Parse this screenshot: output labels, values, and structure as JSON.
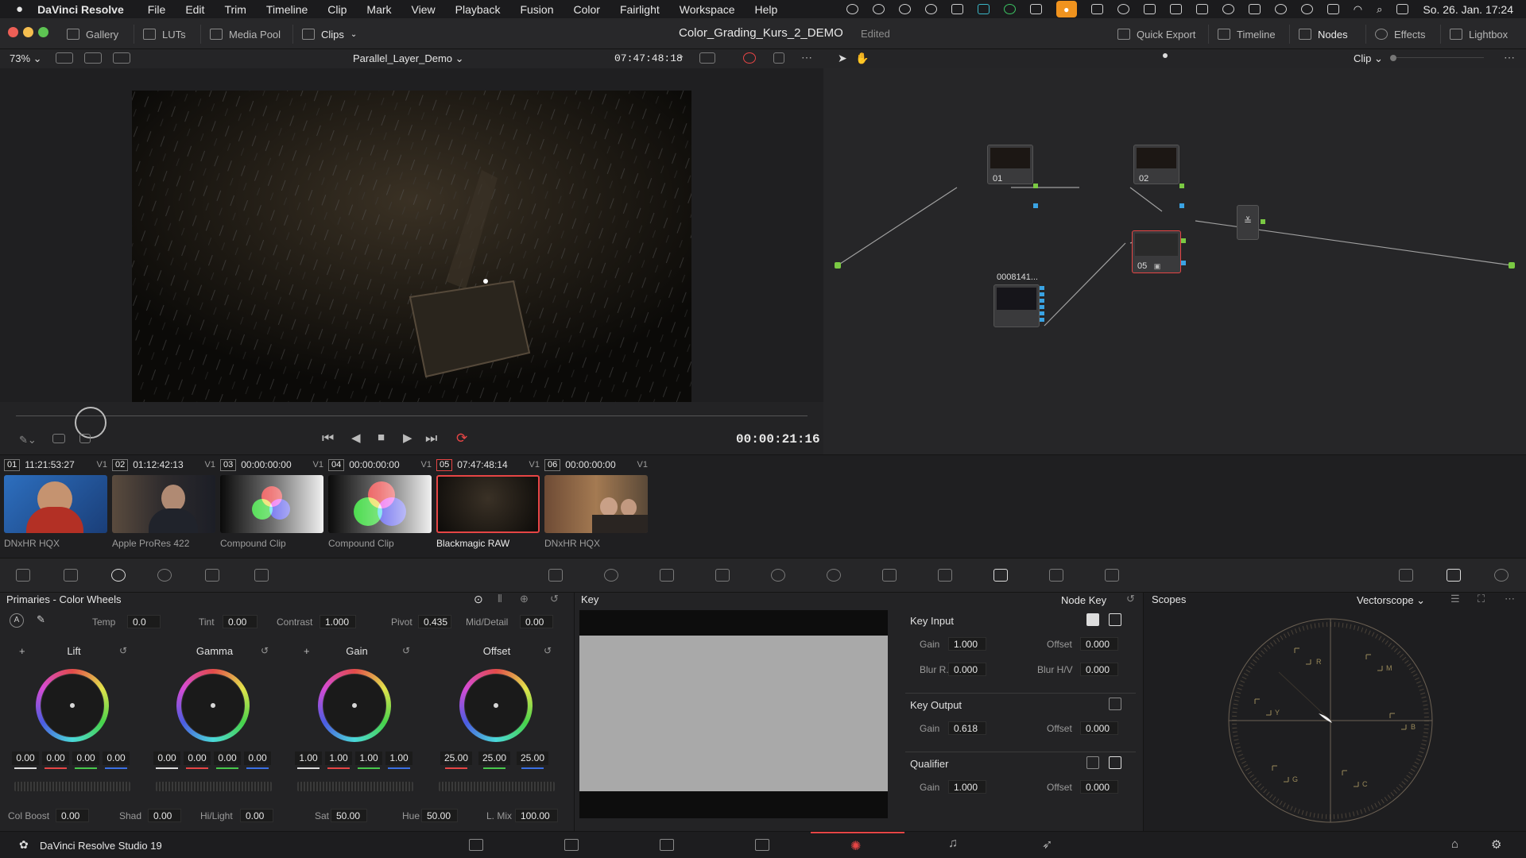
{
  "menubar": {
    "app": "DaVinci Resolve",
    "items": [
      "File",
      "Edit",
      "Trim",
      "Timeline",
      "Clip",
      "Mark",
      "View",
      "Playback",
      "Fusion",
      "Color",
      "Fairlight",
      "Workspace",
      "Help"
    ],
    "datetime": "So. 26. Jan.  17:24"
  },
  "toolbar": {
    "gallery": "Gallery",
    "luts": "LUTs",
    "media_pool": "Media Pool",
    "clips": "Clips",
    "project_title": "Color_Grading_Kurs_2_DEMO",
    "status": "Edited",
    "quick_export": "Quick Export",
    "timeline": "Timeline",
    "nodes": "Nodes",
    "effects": "Effects",
    "lightbox": "Lightbox"
  },
  "viewer": {
    "zoom": "73%",
    "timeline_name": "Parallel_Layer_Demo",
    "timecode_top": "07:47:48:18",
    "timecode": "00:00:21:16"
  },
  "node_editor": {
    "mode": "Clip",
    "nodes": [
      {
        "label": "01"
      },
      {
        "label": "02"
      },
      {
        "label": "05"
      },
      {
        "label": "0008141..."
      }
    ]
  },
  "clips": [
    {
      "num": "01",
      "tc": "11:21:53:27",
      "track": "V1",
      "codec": "DNxHR HQX"
    },
    {
      "num": "02",
      "tc": "01:12:42:13",
      "track": "V1",
      "codec": "Apple ProRes 422"
    },
    {
      "num": "03",
      "tc": "00:00:00:00",
      "track": "V1",
      "codec": "Compound Clip"
    },
    {
      "num": "04",
      "tc": "00:00:00:00",
      "track": "V1",
      "codec": "Compound Clip"
    },
    {
      "num": "05",
      "tc": "07:47:48:14",
      "track": "V1",
      "codec": "Blackmagic RAW"
    },
    {
      "num": "06",
      "tc": "00:00:00:00",
      "track": "V1",
      "codec": "DNxHR HQX"
    }
  ],
  "primaries": {
    "title": "Primaries - Color Wheels",
    "temp_label": "Temp",
    "temp": "0.0",
    "tint_label": "Tint",
    "tint": "0.00",
    "contrast_label": "Contrast",
    "contrast": "1.000",
    "pivot_label": "Pivot",
    "pivot": "0.435",
    "middetail_label": "Mid/Detail",
    "middetail": "0.00",
    "wheels": [
      {
        "name": "Lift",
        "values": [
          "0.00",
          "0.00",
          "0.00",
          "0.00"
        ]
      },
      {
        "name": "Gamma",
        "values": [
          "0.00",
          "0.00",
          "0.00",
          "0.00"
        ]
      },
      {
        "name": "Gain",
        "values": [
          "1.00",
          "1.00",
          "1.00",
          "1.00"
        ]
      },
      {
        "name": "Offset",
        "values": [
          "25.00",
          "25.00",
          "25.00"
        ]
      }
    ],
    "colboost_label": "Col Boost",
    "colboost": "0.00",
    "shad_label": "Shad",
    "shad": "0.00",
    "hilight_label": "Hi/Light",
    "hilight": "0.00",
    "sat_label": "Sat",
    "sat": "50.00",
    "hue_label": "Hue",
    "hue": "50.00",
    "lmix_label": "L. Mix",
    "lmix": "100.00"
  },
  "key": {
    "title": "Key",
    "node_key": "Node Key",
    "key_input": "Key Input",
    "gain_label": "Gain",
    "offset_label": "Offset",
    "blur_r_label": "Blur R.",
    "blur_hv_label": "Blur H/V",
    "ki_gain": "1.000",
    "ki_offset": "0.000",
    "ki_blur_r": "0.000",
    "ki_blur_hv": "0.000",
    "key_output": "Key Output",
    "ko_gain": "0.618",
    "ko_offset": "0.000",
    "qualifier": "Qualifier",
    "q_gain": "1.000",
    "q_offset": "0.000"
  },
  "scopes": {
    "title": "Scopes",
    "type": "Vectorscope",
    "targets": [
      "R",
      "M",
      "B",
      "C",
      "G",
      "Y"
    ]
  },
  "bottom": {
    "app_name": "DaVinci Resolve Studio 19"
  },
  "colors": {
    "accent": "#e64545",
    "node_green": "#7ac943",
    "node_blue": "#3aa3e3"
  }
}
